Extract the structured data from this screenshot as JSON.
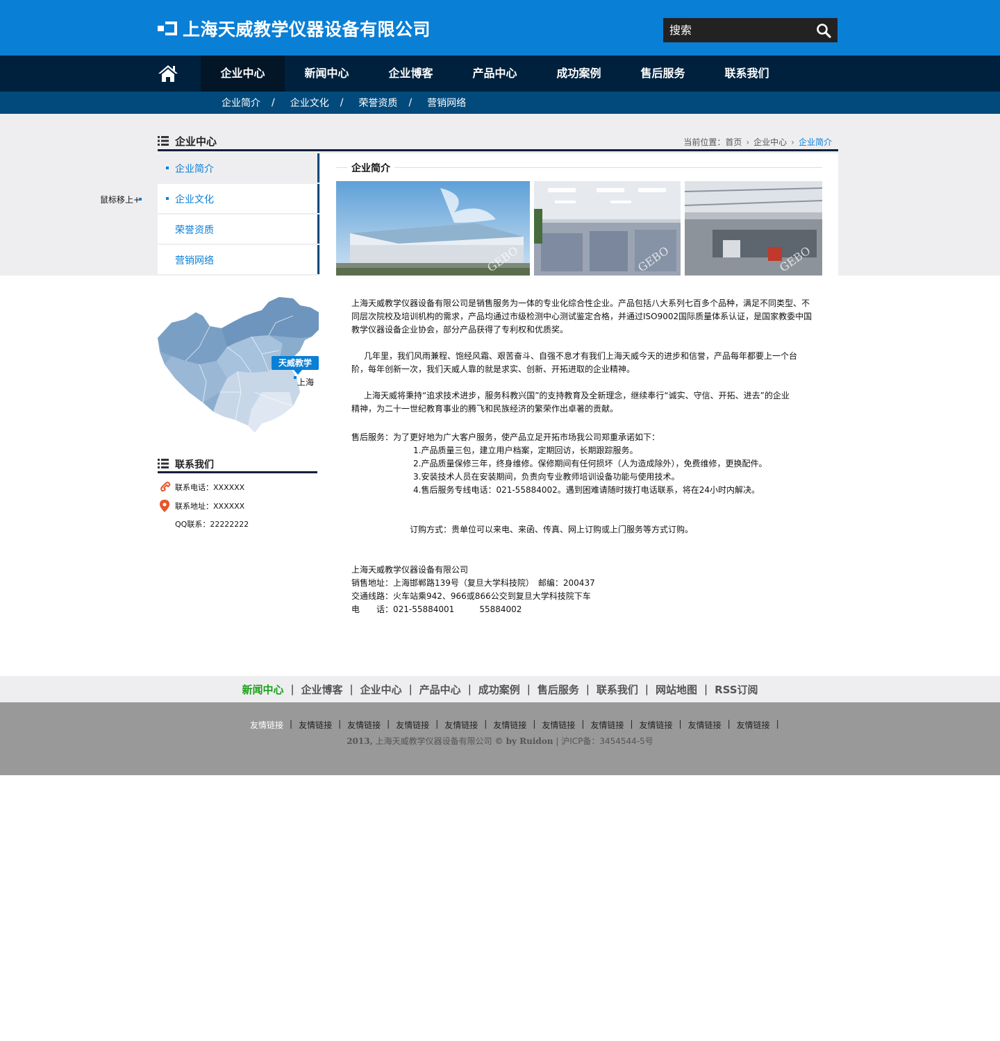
{
  "header": {
    "company_name": "上海天威教学仪器设备有限公司",
    "search_placeholder": "搜索"
  },
  "nav": {
    "items": [
      {
        "label": "企业中心",
        "active": true
      },
      {
        "label": "新闻中心"
      },
      {
        "label": "企业博客"
      },
      {
        "label": "产品中心"
      },
      {
        "label": "成功案例"
      },
      {
        "label": "售后服务"
      },
      {
        "label": "联系我们"
      }
    ]
  },
  "subnav": {
    "items": [
      "企业简介",
      "企业文化",
      "荣誉资质",
      "营销网络"
    ],
    "separator": "/"
  },
  "hover_hint": "鼠标移上+",
  "section": {
    "title": "企业中心",
    "breadcrumb_prefix": "当前位置：",
    "breadcrumb": [
      "首页",
      "企业中心",
      "企业简介"
    ]
  },
  "sidebar": {
    "items": [
      {
        "label": "企业简介",
        "active": true
      },
      {
        "label": "企业文化"
      },
      {
        "label": "荣誉资质"
      },
      {
        "label": "营销网络"
      }
    ]
  },
  "content": {
    "title": "企业简介",
    "photo_watermark": "GEBO"
  },
  "map": {
    "badge": "天威教学",
    "city": "上海"
  },
  "contact": {
    "title": "联系我们",
    "phone": "联系电话：XXXXXX",
    "address": "联系地址：XXXXXX",
    "qq": "QQ联系：22222222"
  },
  "article": {
    "p1a": "上海天威教学仪器设备有限公司是销售服务为一体的专业化综合性企业。产品包括八大系列七百多个品种，满足不同类型、不",
    "p1b": "同层次院校及培训机构的需求，产品均通过市级检测中心测试鉴定合格，并通过ISO9002国际质量体系认证，是国家教委中国",
    "p1c": "教学仪器设备企业协会，部分产品获得了专利权和优质奖。",
    "p2a": "几年里，我们风雨兼程、饱经风霜、艰苦奋斗、自强不息才有我们上海天威今天的进步和信誉，产品每年都要上一个台",
    "p2b": "阶，每年创新一次，我们天威人靠的就是求实、创新、开拓进取的企业精神。",
    "p3a": "上海天威将秉持“追求技术进步，服务科教兴国”的支持教育及全新理念，继续奉行“诚实、守信、开拓、进去”的企业",
    "p3b": "精神，为二十一世纪教育事业的腾飞和民族经济的繁荣作出卓著的贡献。",
    "service_intro": "售后服务：为了更好地为广大客户服务，使产品立足开拓市场我公司郑重承诺如下：",
    "service_items": [
      "1.产品质量三包，建立用户档案，定期回访，长期跟踪服务。",
      "2.产品质量保修三年，终身维修。保修期间有任何损坏（人为造成除外），免费维修，更换配件。",
      "3.安装技术人员在安装期间，负责向专业教师培训设备功能与使用技术。",
      "4.售后服务专线电话：021-55884002。遇到困难请随时拨打电话联系，将在24小时内解决。"
    ],
    "order": "订购方式：贵单位可以来电、来函、传真、网上订购或上门服务等方式订购。",
    "company": "上海天威教学仪器设备有限公司",
    "sales_address": "销售地址：上海邯郸路139号（复旦大学科技院）　邮编：200437",
    "traffic": "交通线路：火车站乘942、966或866公交到复旦大学科技院下车",
    "tel": "电　　话：021-55884001　　　55884002"
  },
  "footer_nav": {
    "items": [
      {
        "label": "新闻中心",
        "active": true
      },
      {
        "label": "企业博客"
      },
      {
        "label": "企业中心"
      },
      {
        "label": "产品中心"
      },
      {
        "label": "成功案例"
      },
      {
        "label": "售后服务"
      },
      {
        "label": "联系我们"
      },
      {
        "label": "网站地图"
      },
      {
        "label": "RSS订阅"
      }
    ]
  },
  "footer": {
    "friend_links": [
      "友情链接",
      "友情链接",
      "友情链接",
      "友情链接",
      "友情链接",
      "友情链接",
      "友情链接",
      "友情链接",
      "友情链接",
      "友情链接",
      "友情链接"
    ],
    "copyright_a": "2013,",
    "copyright_b": "上海天威教学仪器设备有限公司",
    "copyright_c": "© by Ruidon",
    "copyright_d": "沪ICP备：3454544-5号"
  },
  "colors": {
    "header_blue": "#0a7fd6",
    "nav_dark": "#00213d",
    "subnav_blue": "#034a7c",
    "band_gray": "#eeeef0",
    "footer_gray": "#999999",
    "footer_active_green": "#1aa01a"
  }
}
